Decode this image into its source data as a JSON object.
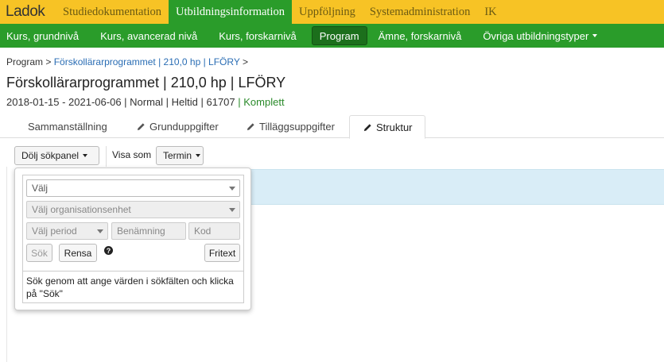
{
  "app": {
    "logo": "Ladok"
  },
  "topnav": [
    {
      "label": "Studiedokumentation",
      "active": false
    },
    {
      "label": "Utbildningsinformation",
      "active": true
    },
    {
      "label": "Uppföljning",
      "active": false
    },
    {
      "label": "Systemadministration",
      "active": false
    },
    {
      "label": "IK",
      "active": false
    }
  ],
  "subnav": [
    {
      "label": "Kurs, grundnivå"
    },
    {
      "label": "Kurs, avancerad nivå"
    },
    {
      "label": "Kurs, forskarnivå"
    },
    {
      "label": "Program",
      "active": true
    },
    {
      "label": "Ämne, forskarnivå"
    },
    {
      "label": "Övriga utbildningstyper"
    }
  ],
  "breadcrumb": {
    "root": "Program",
    "sep": ">",
    "current": "Förskollärarprogrammet | 210,0 hp | LFÖRY"
  },
  "page": {
    "title": "Förskollärarprogrammet | 210,0 hp | LFÖRY",
    "meta": "2018-01-15 - 2021-06-06 | Normal | Heltid | 61707",
    "status": "| Komplett"
  },
  "tabs": [
    {
      "label": "Sammanställning"
    },
    {
      "label": "Grunduppgifter"
    },
    {
      "label": "Tilläggsuppgifter"
    },
    {
      "label": "Struktur",
      "active": true
    }
  ],
  "toolbar": {
    "toggle_search": "Dölj sökpanel",
    "show_as_label": "Visa som",
    "show_as_value": "Termin"
  },
  "search": {
    "select_placeholder": "Välj",
    "org_placeholder": "Välj organisationsenhet",
    "period_placeholder": "Välj period",
    "name_placeholder": "Benämning",
    "code_placeholder": "Kod",
    "search_btn": "Sök",
    "clear_btn": "Rensa",
    "help": "?",
    "freetext_btn": "Fritext",
    "hint": "Sök genom att ange värden i sökfälten och klicka på \"Sök\""
  },
  "colors": {
    "topbar": "#f7c325",
    "green": "#2a9c2a",
    "link": "#2a6db4",
    "info_strip": "#d9edf7"
  }
}
